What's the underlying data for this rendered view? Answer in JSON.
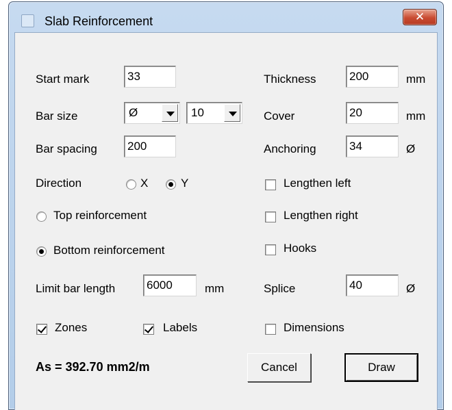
{
  "window": {
    "title": "Slab Reinforcement",
    "close_glyph": "✕"
  },
  "left": {
    "start_mark_label": "Start mark",
    "start_mark_value": "33",
    "bar_size_label": "Bar size",
    "bar_symbol_value": "Ø",
    "bar_size_value": "10",
    "bar_spacing_label": "Bar spacing",
    "bar_spacing_value": "200",
    "direction_label": "Direction",
    "direction_x_label": "X",
    "direction_y_label": "Y",
    "direction_selected": "Y",
    "top_reinforcement_label": "Top reinforcement",
    "bottom_reinforcement_label": "Bottom reinforcement",
    "reinforcement_selected": "bottom",
    "limit_bar_length_label": "Limit bar length",
    "limit_bar_length_value": "6000",
    "limit_bar_length_unit": "mm",
    "zones_label": "Zones",
    "zones_checked": true,
    "labels_label": "Labels",
    "labels_checked": true,
    "result_text": "As = 392.70 mm2/m"
  },
  "right": {
    "thickness_label": "Thickness",
    "thickness_value": "200",
    "thickness_unit": "mm",
    "cover_label": "Cover",
    "cover_value": "20",
    "cover_unit": "mm",
    "anchoring_label": "Anchoring",
    "anchoring_value": "34",
    "anchoring_unit": "Ø",
    "lengthen_left_label": "Lengthen left",
    "lengthen_left_checked": false,
    "lengthen_right_label": "Lengthen right",
    "lengthen_right_checked": false,
    "hooks_label": "Hooks",
    "hooks_checked": false,
    "splice_label": "Splice",
    "splice_value": "40",
    "splice_unit": "Ø",
    "dimensions_label": "Dimensions",
    "dimensions_checked": false
  },
  "buttons": {
    "cancel_label": "Cancel",
    "draw_label": "Draw"
  },
  "colors": {
    "titlebar": "#b9d1ea",
    "close_button": "#c94b32",
    "dialog_face": "#f0f0f0"
  }
}
